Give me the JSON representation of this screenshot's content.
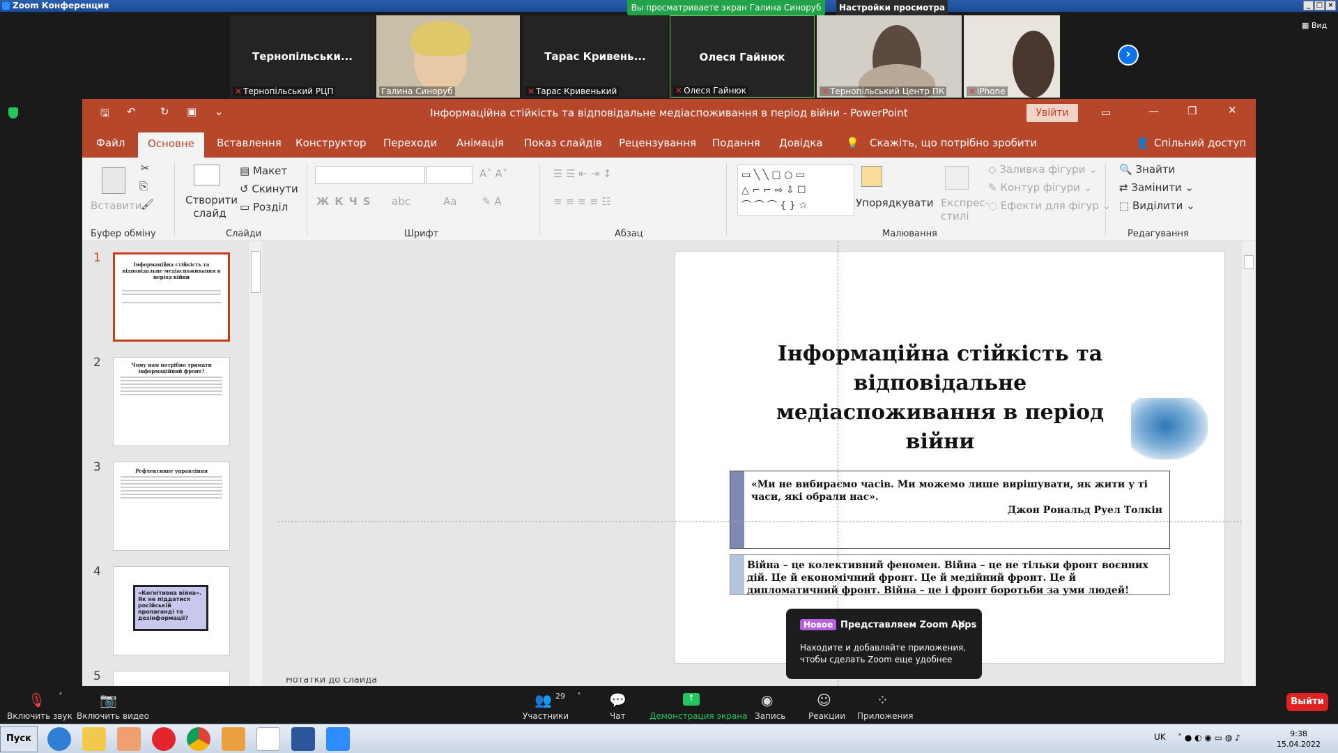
{
  "zoom": {
    "window_title": "Zoom Конференция",
    "share_banner": "Вы просматриваете экран Галина Синоруб",
    "view_options": "Настройки просмотра ⌄",
    "view_label": "Вид",
    "participants": [
      {
        "display": "Тернопільськи...",
        "label": "Тернопільський РЦП",
        "muted": true
      },
      {
        "display": "",
        "label": "Галина Синоруб",
        "muted": false
      },
      {
        "display": "Тарас Кривень...",
        "label": "Тарас Кривенький",
        "muted": true
      },
      {
        "display": "Олеся Гайнюк",
        "label": "Олеся Гайнюк",
        "muted": true
      },
      {
        "display": "",
        "label": "Тернопільський Центр ПК",
        "muted": true
      },
      {
        "display": "",
        "label": "iPhone",
        "muted": true
      }
    ]
  },
  "ppt": {
    "title": "Інформаційна стійкість та відповідальне медіаспоживання в період війни  -  PowerPoint",
    "sign_in": "Увійти",
    "tabs": [
      "Файл",
      "Основне",
      "Вставлення",
      "Конструктор",
      "Переходи",
      "Анімація",
      "Показ слайдів",
      "Рецензування",
      "Подання",
      "Довідка"
    ],
    "tell_me": "Скажіть, що потрібно зробити",
    "share": "Спільний доступ",
    "ribbon": {
      "paste": "Вставити",
      "new_slide": "Створити слайд",
      "layout": "Макет",
      "reset": "Скинути",
      "section": "Розділ",
      "arrange": "Упорядкувати",
      "quick_styles": "Експрес-стилі",
      "shape_fill": "Заливка фігури",
      "shape_outline": "Контур фігури",
      "shape_effects": "Ефекти для фігур",
      "find": "Знайти",
      "replace": "Замінити",
      "select": "Виділити",
      "groups": [
        "Буфер обміну",
        "Слайди",
        "Шрифт",
        "Абзац",
        "Малювання",
        "Редагування"
      ]
    },
    "thumbnails": [
      {
        "num": "1",
        "title": "Інформаційна стійкість та відповідальне медіаспоживання в період війни"
      },
      {
        "num": "2",
        "title": "Чому нам потрібно тримати інформаційний фронт?"
      },
      {
        "num": "3",
        "title": "Рефлексивне управління"
      },
      {
        "num": "4",
        "title": "«Когнітивна війна». Як не піддатися російській пропаганді та дезінформації?"
      },
      {
        "num": "5",
        "title": ""
      }
    ],
    "slide": {
      "title": "Інформаційна стійкість та відповідальне медіаспоживання в період війни",
      "quote": "«Ми не вибираємо часів. Ми можемо лише вирішувати, як жити у ті часи, які обрали нас».",
      "quote_author": "Джон Рональд Руел Толкін",
      "war_text": "Війна – це колективний феномен. Війна – це не тільки фронт воєнних дій. Це й економічний фронт. Це й медійний фронт. Це й дипломатичний фронт. Війна – це і фронт боротьби за уми людей!"
    },
    "notes": "Нотатки до слайда"
  },
  "toast": {
    "badge": "Новое",
    "title": "Представляем Zoom Apps",
    "body": "Находите и добавляйте приложения, чтобы сделать Zoom еще удобнее"
  },
  "toolbar": {
    "unmute": "Включить звук",
    "start_video": "Включить видео",
    "participants": "Участники",
    "participants_count": "29",
    "chat": "Чат",
    "share": "Демонстрация экрана",
    "record": "Запись",
    "reactions": "Реакции",
    "apps": "Приложения",
    "leave": "Выйти"
  },
  "taskbar": {
    "start": "Пуск",
    "lang": "UK",
    "time": "9:38",
    "date": "15.04.2022"
  }
}
